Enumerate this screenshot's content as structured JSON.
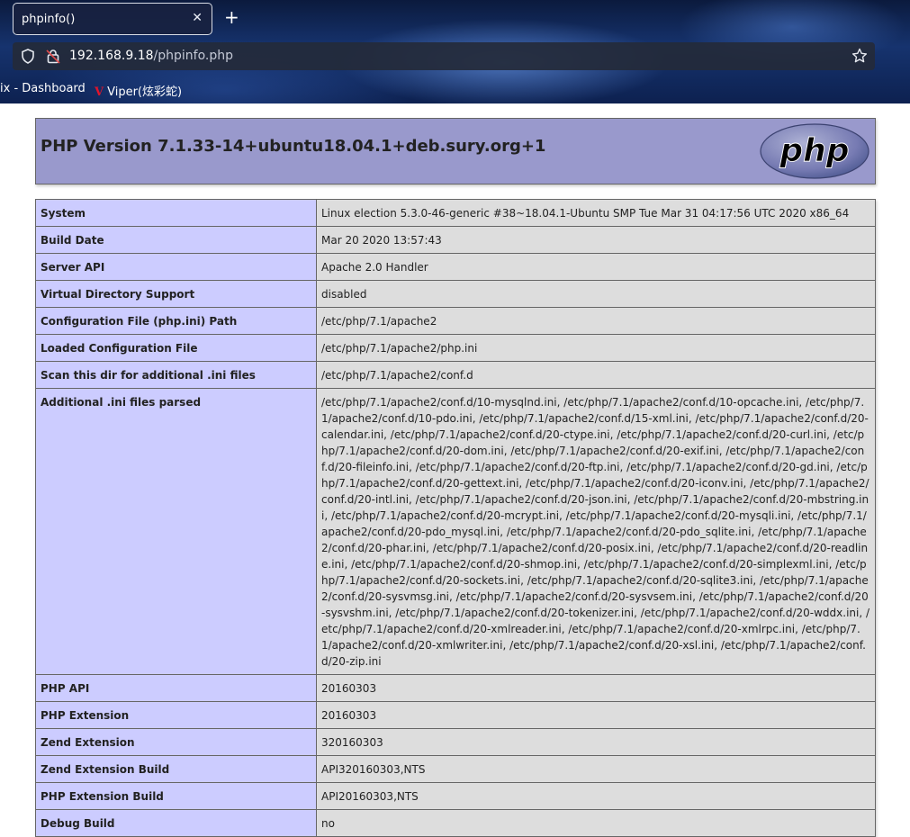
{
  "browser": {
    "tab_title": "phpinfo()",
    "new_tab_icon": "plus-icon",
    "url_host": "192.168.9.18",
    "url_path": "/phpinfo.php",
    "bookmarks": [
      {
        "label": "ix - Dashboard"
      },
      {
        "label": "Viper(炫彩蛇)",
        "logo": "V"
      }
    ]
  },
  "page": {
    "title": "PHP Version 7.1.33-14+ubuntu18.04.1+deb.sury.org+1",
    "logo_text": "php",
    "colors": {
      "header_bg": "#9999cc",
      "label_bg": "#ccccff",
      "value_bg": "#dddddd",
      "border": "#666666"
    }
  },
  "rows": [
    {
      "label": "System",
      "value": "Linux election 5.3.0-46-generic #38~18.04.1-Ubuntu SMP Tue Mar 31 04:17:56 UTC 2020 x86_64"
    },
    {
      "label": "Build Date",
      "value": "Mar 20 2020 13:57:43"
    },
    {
      "label": "Server API",
      "value": "Apache 2.0 Handler"
    },
    {
      "label": "Virtual Directory Support",
      "value": "disabled"
    },
    {
      "label": "Configuration File (php.ini) Path",
      "value": "/etc/php/7.1/apache2"
    },
    {
      "label": "Loaded Configuration File",
      "value": "/etc/php/7.1/apache2/php.ini"
    },
    {
      "label": "Scan this dir for additional .ini files",
      "value": "/etc/php/7.1/apache2/conf.d"
    },
    {
      "label": "Additional .ini files parsed",
      "value": "/etc/php/7.1/apache2/conf.d/10-mysqlnd.ini, /etc/php/7.1/apache2/conf.d/10-opcache.ini, /etc/php/7.1/apache2/conf.d/10-pdo.ini, /etc/php/7.1/apache2/conf.d/15-xml.ini, /etc/php/7.1/apache2/conf.d/20-calendar.ini, /etc/php/7.1/apache2/conf.d/20-ctype.ini, /etc/php/7.1/apache2/conf.d/20-curl.ini, /etc/php/7.1/apache2/conf.d/20-dom.ini, /etc/php/7.1/apache2/conf.d/20-exif.ini, /etc/php/7.1/apache2/conf.d/20-fileinfo.ini, /etc/php/7.1/apache2/conf.d/20-ftp.ini, /etc/php/7.1/apache2/conf.d/20-gd.ini, /etc/php/7.1/apache2/conf.d/20-gettext.ini, /etc/php/7.1/apache2/conf.d/20-iconv.ini, /etc/php/7.1/apache2/conf.d/20-intl.ini, /etc/php/7.1/apache2/conf.d/20-json.ini, /etc/php/7.1/apache2/conf.d/20-mbstring.ini, /etc/php/7.1/apache2/conf.d/20-mcrypt.ini, /etc/php/7.1/apache2/conf.d/20-mysqli.ini, /etc/php/7.1/apache2/conf.d/20-pdo_mysql.ini, /etc/php/7.1/apache2/conf.d/20-pdo_sqlite.ini, /etc/php/7.1/apache2/conf.d/20-phar.ini, /etc/php/7.1/apache2/conf.d/20-posix.ini, /etc/php/7.1/apache2/conf.d/20-readline.ini, /etc/php/7.1/apache2/conf.d/20-shmop.ini, /etc/php/7.1/apache2/conf.d/20-simplexml.ini, /etc/php/7.1/apache2/conf.d/20-sockets.ini, /etc/php/7.1/apache2/conf.d/20-sqlite3.ini, /etc/php/7.1/apache2/conf.d/20-sysvmsg.ini, /etc/php/7.1/apache2/conf.d/20-sysvsem.ini, /etc/php/7.1/apache2/conf.d/20-sysvshm.ini, /etc/php/7.1/apache2/conf.d/20-tokenizer.ini, /etc/php/7.1/apache2/conf.d/20-wddx.ini, /etc/php/7.1/apache2/conf.d/20-xmlreader.ini, /etc/php/7.1/apache2/conf.d/20-xmlrpc.ini, /etc/php/7.1/apache2/conf.d/20-xmlwriter.ini, /etc/php/7.1/apache2/conf.d/20-xsl.ini, /etc/php/7.1/apache2/conf.d/20-zip.ini"
    },
    {
      "label": "PHP API",
      "value": "20160303"
    },
    {
      "label": "PHP Extension",
      "value": "20160303"
    },
    {
      "label": "Zend Extension",
      "value": "320160303"
    },
    {
      "label": "Zend Extension Build",
      "value": "API320160303,NTS"
    },
    {
      "label": "PHP Extension Build",
      "value": "API20160303,NTS"
    },
    {
      "label": "Debug Build",
      "value": "no"
    }
  ]
}
